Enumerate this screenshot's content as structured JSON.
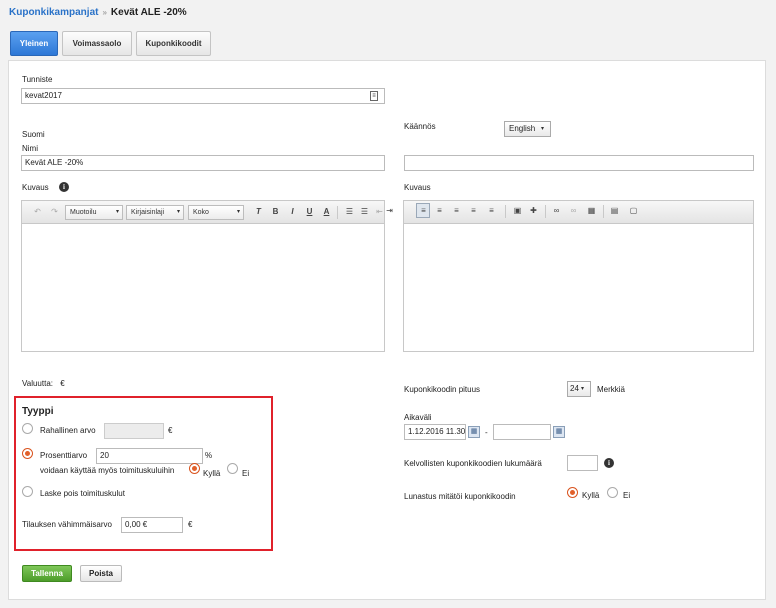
{
  "breadcrumb": {
    "parent": "Kuponkikampanjat",
    "separator": "»",
    "current": "Kevät ALE -20%"
  },
  "tabs": [
    {
      "label": "Yleinen",
      "active": true
    },
    {
      "label": "Voimassaolo",
      "active": false
    },
    {
      "label": "Kuponkikoodit",
      "active": false
    }
  ],
  "identifier": {
    "label": "Tunniste",
    "value": "kevat2017"
  },
  "language": {
    "label": "Suomi"
  },
  "translation": {
    "label": "Käännös",
    "selected": "English"
  },
  "name": {
    "label": "Nimi",
    "value": "Kevät ALE -20%",
    "translated_value": ""
  },
  "description": {
    "label": "Kuvaus",
    "translated_label": "Kuvaus"
  },
  "editor_toolbar": {
    "format": "Muotoilu",
    "font": "Kirjaisinlaji",
    "size": "Koko"
  },
  "currency": {
    "label": "Valuutta:",
    "value": "€"
  },
  "type": {
    "title": "Tyyppi",
    "fixed": {
      "label": "Rahallinen arvo",
      "value": "",
      "unit": "€",
      "selected": false
    },
    "percent": {
      "label": "Prosenttiarvo",
      "value": "20",
      "unit": "%",
      "selected": true
    },
    "shipping_note": "voidaan käyttää myös toimituskuluihin",
    "yes": "Kyllä",
    "no": "Ei",
    "free_shipping": {
      "label": "Laske pois toimituskulut",
      "selected": false
    },
    "min_order": {
      "label": "Tilauksen vähimmäisarvo",
      "value": "0,00 €",
      "unit": "€"
    }
  },
  "code_length": {
    "label": "Kuponkikoodin pituus",
    "value": "24",
    "unit": "Merkkiä"
  },
  "interval": {
    "label": "Aikaväli",
    "start": "1.12.2016 11.30",
    "dash": "-",
    "end": ""
  },
  "valid_count": {
    "label": "Kelvollisten kuponkikoodien lukumäärä",
    "value": ""
  },
  "redeem": {
    "label": "Lunastus mitätöi kuponkikoodin",
    "yes": "Kyllä",
    "no": "Ei",
    "selected": "yes"
  },
  "actions": {
    "save": "Tallenna",
    "delete": "Poista"
  },
  "colors": {
    "accent": "#2e78d6",
    "save": "#4d9d2a",
    "highlight": "#e0212b",
    "radio": "#e2602a"
  }
}
